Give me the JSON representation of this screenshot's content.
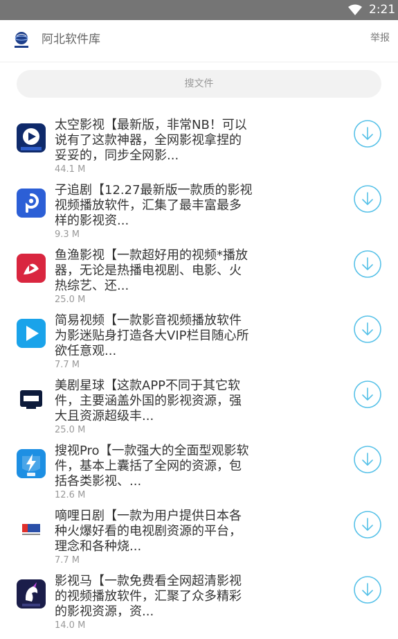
{
  "status_bar": {
    "time": "2:21",
    "icon": "wifi-icon"
  },
  "header": {
    "logo_icon": "app-logo-icon",
    "title": "阿北软件库",
    "report_label": "举报"
  },
  "search": {
    "placeholder": "搜文件"
  },
  "colors": {
    "accent": "#56c1e8",
    "status_bar": "#757575",
    "text": "#333333",
    "muted": "#999999"
  },
  "apps": [
    {
      "desc_lines": [
        "太空影视【最新版，非常NB！可以",
        "说有了这款神器，全网影视拿捏的",
        "妥妥的，同步全网影..."
      ],
      "size": "44.1 M",
      "icon": "space-video-icon"
    },
    {
      "desc_lines": [
        "子追剧【12.27最新版一款质的影视",
        "视频播放软件，汇集了最丰富最多",
        "样的影视资..."
      ],
      "size": "9.3 M",
      "icon": "zizhuiju-icon"
    },
    {
      "desc_lines": [
        "鱼渔影视【一款超好用的视频*播放",
        "器，无论是热播电视剧、电影、火",
        "热综艺、还..."
      ],
      "size": "25.0 M",
      "icon": "yuyu-video-icon"
    },
    {
      "desc_lines": [
        "简易视频【一款影音视频播放软件",
        "为影迷贴身打造各大VIP栏目随心所",
        "欲任意观..."
      ],
      "size": "7.7 M",
      "icon": "jianyi-video-icon"
    },
    {
      "desc_lines": [
        "美剧星球【这款APP不同于其它软",
        "件，主要涵盖外国的影视资源，强",
        "大且资源超级丰..."
      ],
      "size": "25.0 M",
      "icon": "meiju-icon"
    },
    {
      "desc_lines": [
        "搜视Pro【一款强大的全面型观影软",
        "件，基本上囊括了全网的资源，包",
        "括各类影视、..."
      ],
      "size": "12.6 M",
      "icon": "soushi-pro-icon"
    },
    {
      "desc_lines": [
        "嘀哩日剧【一款为用户提供日本各",
        "种火爆好看的电视剧资源的平台，",
        "理念和各种烧..."
      ],
      "size": "7.7 M",
      "icon": "dili-riju-icon"
    },
    {
      "desc_lines": [
        "影视马【一款免费看全网超清影视",
        "的视频播放软件，汇聚了众多精彩",
        "的影视资源，资..."
      ],
      "size": "14.0 M",
      "icon": "yingshima-icon"
    }
  ]
}
